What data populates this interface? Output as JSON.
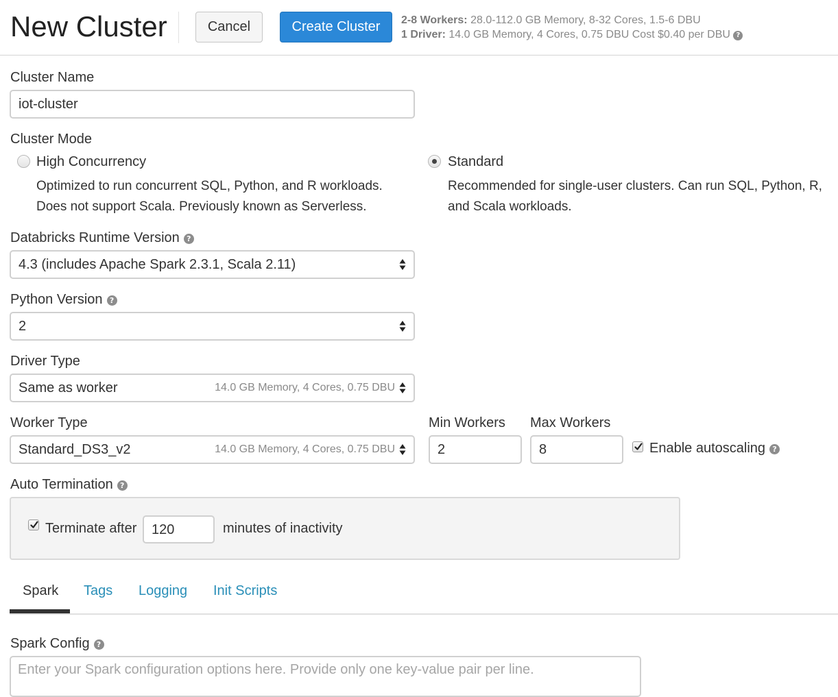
{
  "header": {
    "title": "New Cluster",
    "cancel_label": "Cancel",
    "create_label": "Create Cluster",
    "workers_label": "2-8 Workers:",
    "workers_info": "28.0-112.0 GB Memory, 8-32 Cores, 1.5-6 DBU",
    "driver_label": "1 Driver:",
    "driver_info": "14.0 GB Memory, 4 Cores, 0.75 DBU Cost $0.40 per DBU"
  },
  "cluster_name": {
    "label": "Cluster Name",
    "value": "iot-cluster"
  },
  "cluster_mode": {
    "label": "Cluster Mode",
    "options": [
      {
        "label": "High Concurrency",
        "description_line1": "Optimized to run concurrent SQL, Python, and R workloads.",
        "description_line2": "Does not support Scala. Previously known as Serverless.",
        "selected": false
      },
      {
        "label": "Standard",
        "description_line1": "Recommended for single-user clusters. Can run SQL, Python, R,",
        "description_line2": "and Scala workloads.",
        "selected": true
      }
    ]
  },
  "runtime": {
    "label": "Databricks Runtime Version",
    "value": "4.3 (includes Apache Spark 2.3.1, Scala 2.11)"
  },
  "python": {
    "label": "Python Version",
    "value": "2"
  },
  "driver_type": {
    "label": "Driver Type",
    "value": "Same as worker",
    "hint": "14.0 GB Memory, 4 Cores, 0.75 DBU"
  },
  "worker_type": {
    "label": "Worker Type",
    "value": "Standard_DS3_v2",
    "hint": "14.0 GB Memory, 4 Cores, 0.75 DBU"
  },
  "min_workers": {
    "label": "Min Workers",
    "value": "2"
  },
  "max_workers": {
    "label": "Max Workers",
    "value": "8"
  },
  "autoscaling": {
    "label": "Enable autoscaling",
    "checked": true
  },
  "auto_termination": {
    "label": "Auto Termination",
    "checkbox_label": "Terminate after",
    "value": "120",
    "suffix": "minutes of inactivity",
    "checked": true
  },
  "tabs": [
    {
      "label": "Spark",
      "active": true
    },
    {
      "label": "Tags",
      "active": false
    },
    {
      "label": "Logging",
      "active": false
    },
    {
      "label": "Init Scripts",
      "active": false
    }
  ],
  "spark_config": {
    "label": "Spark Config",
    "placeholder": "Enter your Spark configuration options here. Provide only one key-value pair per line."
  },
  "colors": {
    "primary_button": "#2b88d8",
    "link": "#2a8fb8",
    "panel_background": "#f4f4f4"
  },
  "icons": {
    "help": "question-circle",
    "select_arrows": "up-down-caret",
    "check": "checkmark"
  }
}
